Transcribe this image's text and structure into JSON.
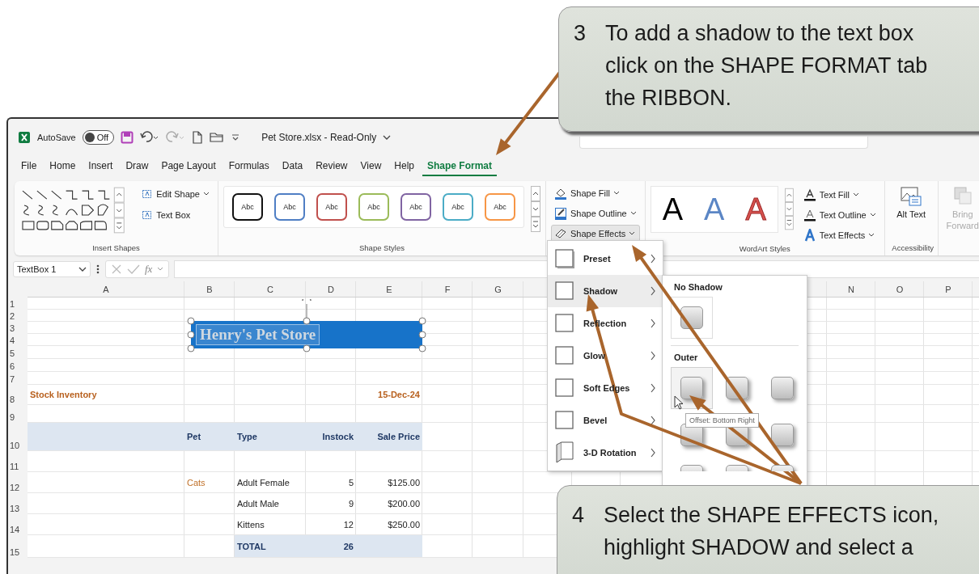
{
  "title_bar": {
    "autosave": {
      "label": "AutoSave",
      "state": "Off",
      "on": false
    },
    "file_name": "Pet Store.xlsx  -  Read-Only"
  },
  "tabs": [
    {
      "label": "File",
      "selected": false
    },
    {
      "label": "Home",
      "selected": false
    },
    {
      "label": "Insert",
      "selected": false
    },
    {
      "label": "Draw",
      "selected": false
    },
    {
      "label": "Page Layout",
      "selected": false
    },
    {
      "label": "Formulas",
      "selected": false
    },
    {
      "label": "Data",
      "selected": false
    },
    {
      "label": "Review",
      "selected": false
    },
    {
      "label": "View",
      "selected": false
    },
    {
      "label": "Help",
      "selected": false
    },
    {
      "label": "Shape Format",
      "selected": true
    }
  ],
  "ribbon": {
    "insert_shapes": {
      "buttons": [
        {
          "label": "Edit Shape",
          "dropdown": true
        },
        {
          "label": "Text Box",
          "dropdown": false
        }
      ],
      "group_label": "Insert Shapes"
    },
    "shape_styles": {
      "swatches": [
        {
          "text": "Abc",
          "color": "#111111"
        },
        {
          "text": "Abc",
          "color": "#4f7ec4"
        },
        {
          "text": "Abc",
          "color": "#c0504d"
        },
        {
          "text": "Abc",
          "color": "#9bbb59"
        },
        {
          "text": "Abc",
          "color": "#8064a2"
        },
        {
          "text": "Abc",
          "color": "#4bacc6"
        },
        {
          "text": "Abc",
          "color": "#f79646"
        }
      ],
      "group_label": "Shape Styles"
    },
    "shape_buttons": [
      {
        "label": "Shape Fill",
        "kind": "fill",
        "selected": false
      },
      {
        "label": "Shape Outline",
        "kind": "outline",
        "selected": false
      },
      {
        "label": "Shape Effects",
        "kind": "effects",
        "selected": true
      }
    ],
    "wordart": {
      "samples": [
        {
          "text": "A",
          "color": "#000000",
          "kind": "solid"
        },
        {
          "text": "A",
          "color": "#5b86c5",
          "kind": "solid"
        },
        {
          "text": "A",
          "color": "#d9534f",
          "kind": "outline"
        }
      ],
      "buttons": [
        {
          "label": "Text Fill",
          "kind": "fill"
        },
        {
          "label": "Text Outline",
          "kind": "outline"
        },
        {
          "label": "Text Effects",
          "kind": "effects"
        }
      ],
      "group_label": "WordArt Styles"
    },
    "accessibility": {
      "button": "Alt Text",
      "group_label": "Accessibility"
    },
    "arrange": {
      "button": "Bring Forward",
      "disabled": true
    }
  },
  "formula_bar": {
    "name_box": "TextBox 1",
    "function_label": "fx"
  },
  "sheet": {
    "columns": [
      "A",
      "B",
      "C",
      "D",
      "E",
      "F",
      "G",
      null,
      null,
      null,
      null,
      null,
      null,
      "N",
      "O",
      "P"
    ],
    "rows": [
      {
        "number": "1",
        "kind": "plain",
        "cells": []
      },
      {
        "number": "2",
        "kind": "plain",
        "cells": []
      },
      {
        "number": "3",
        "kind": "plain",
        "cells": []
      },
      {
        "number": "4",
        "kind": "plain",
        "cells": []
      },
      {
        "number": "5",
        "kind": "plain",
        "cells": []
      },
      {
        "number": "6",
        "kind": "plain",
        "cells": []
      },
      {
        "number": "7",
        "kind": "plain",
        "cells": []
      },
      {
        "number": "8",
        "kind": "title",
        "cells": [
          "Stock Inventory",
          null,
          null,
          null,
          "15-Dec-24"
        ]
      },
      {
        "number": "9",
        "kind": "plain",
        "cells": []
      },
      {
        "number": "10",
        "kind": "header",
        "cells": [
          null,
          "Pet",
          "Type",
          "Instock",
          "Sale Price"
        ]
      },
      {
        "number": "11",
        "kind": "plain",
        "cells": []
      },
      {
        "number": "12",
        "kind": "item",
        "cells": [
          null,
          "Cats",
          "Adult Female",
          "5",
          "$125.00"
        ]
      },
      {
        "number": "13",
        "kind": "item",
        "cells": [
          null,
          null,
          "Adult Male",
          "9",
          "$200.00"
        ]
      },
      {
        "number": "14",
        "kind": "item",
        "cells": [
          null,
          null,
          "Kittens",
          "12",
          "$250.00"
        ]
      },
      {
        "number": "15",
        "kind": "total",
        "cells": [
          null,
          null,
          "TOTAL",
          "26",
          null
        ]
      }
    ],
    "text_box": {
      "text": "Henry's Pet Store"
    }
  },
  "effects_menu": {
    "items": [
      {
        "label": "Preset",
        "kind": "preset",
        "selected": false
      },
      {
        "label": "Shadow",
        "kind": "plain",
        "selected": true
      },
      {
        "label": "Reflection",
        "kind": "plain",
        "selected": false
      },
      {
        "label": "Glow",
        "kind": "plain",
        "selected": false
      },
      {
        "label": "Soft Edges",
        "kind": "plain",
        "selected": false
      },
      {
        "label": "Bevel",
        "kind": "plain",
        "selected": false
      },
      {
        "label": "3-D Rotation",
        "kind": "rotation",
        "selected": false
      }
    ]
  },
  "shadow_menu": {
    "sections": [
      {
        "title": "No Shadow",
        "kind": "none",
        "options": [
          {
            "selected": false
          }
        ]
      },
      {
        "title": "Outer",
        "kind": "outer",
        "options": [
          {
            "selected": true
          },
          {
            "selected": false
          },
          {
            "selected": false
          },
          {
            "selected": false
          },
          {
            "selected": false
          },
          {
            "selected": false
          },
          {
            "selected": false
          },
          {
            "selected": false
          },
          {
            "selected": false
          }
        ]
      }
    ],
    "tooltip": "Offset: Bottom Right"
  },
  "callouts": [
    {
      "number": "3",
      "lines": [
        "To add a shadow to the text box",
        "click on the SHAPE FORMAT tab",
        "the RIBBON."
      ],
      "kind": "top"
    },
    {
      "number": "4",
      "lines": [
        "Select the SHAPE EFFECTS icon,",
        "highlight SHADOW and select a"
      ],
      "kind": "bottom"
    }
  ]
}
